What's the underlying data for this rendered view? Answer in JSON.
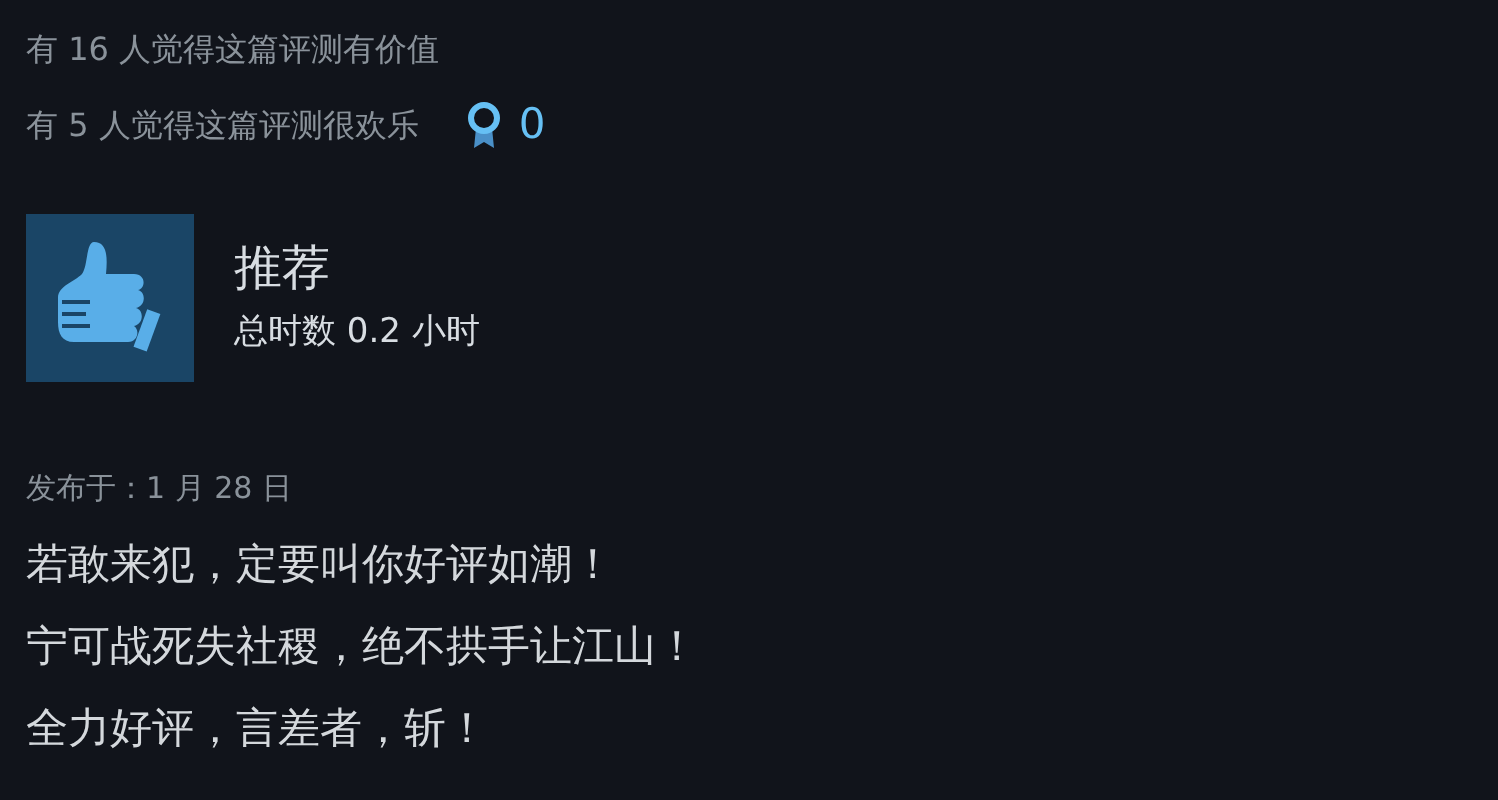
{
  "votes": {
    "helpful": "有 16 人觉得这篇评测有价值",
    "funny": "有 5 人觉得这篇评测很欢乐",
    "awards": "0"
  },
  "review": {
    "verdict": "推荐",
    "hours": "总时数 0.2 小时",
    "posted": "发布于：1 月 28 日",
    "lines": [
      "若敢来犯，定要叫你好评如潮！",
      "宁可战死失社稷，绝不拱手让江山！",
      "全力好评，言差者，斩！"
    ]
  }
}
